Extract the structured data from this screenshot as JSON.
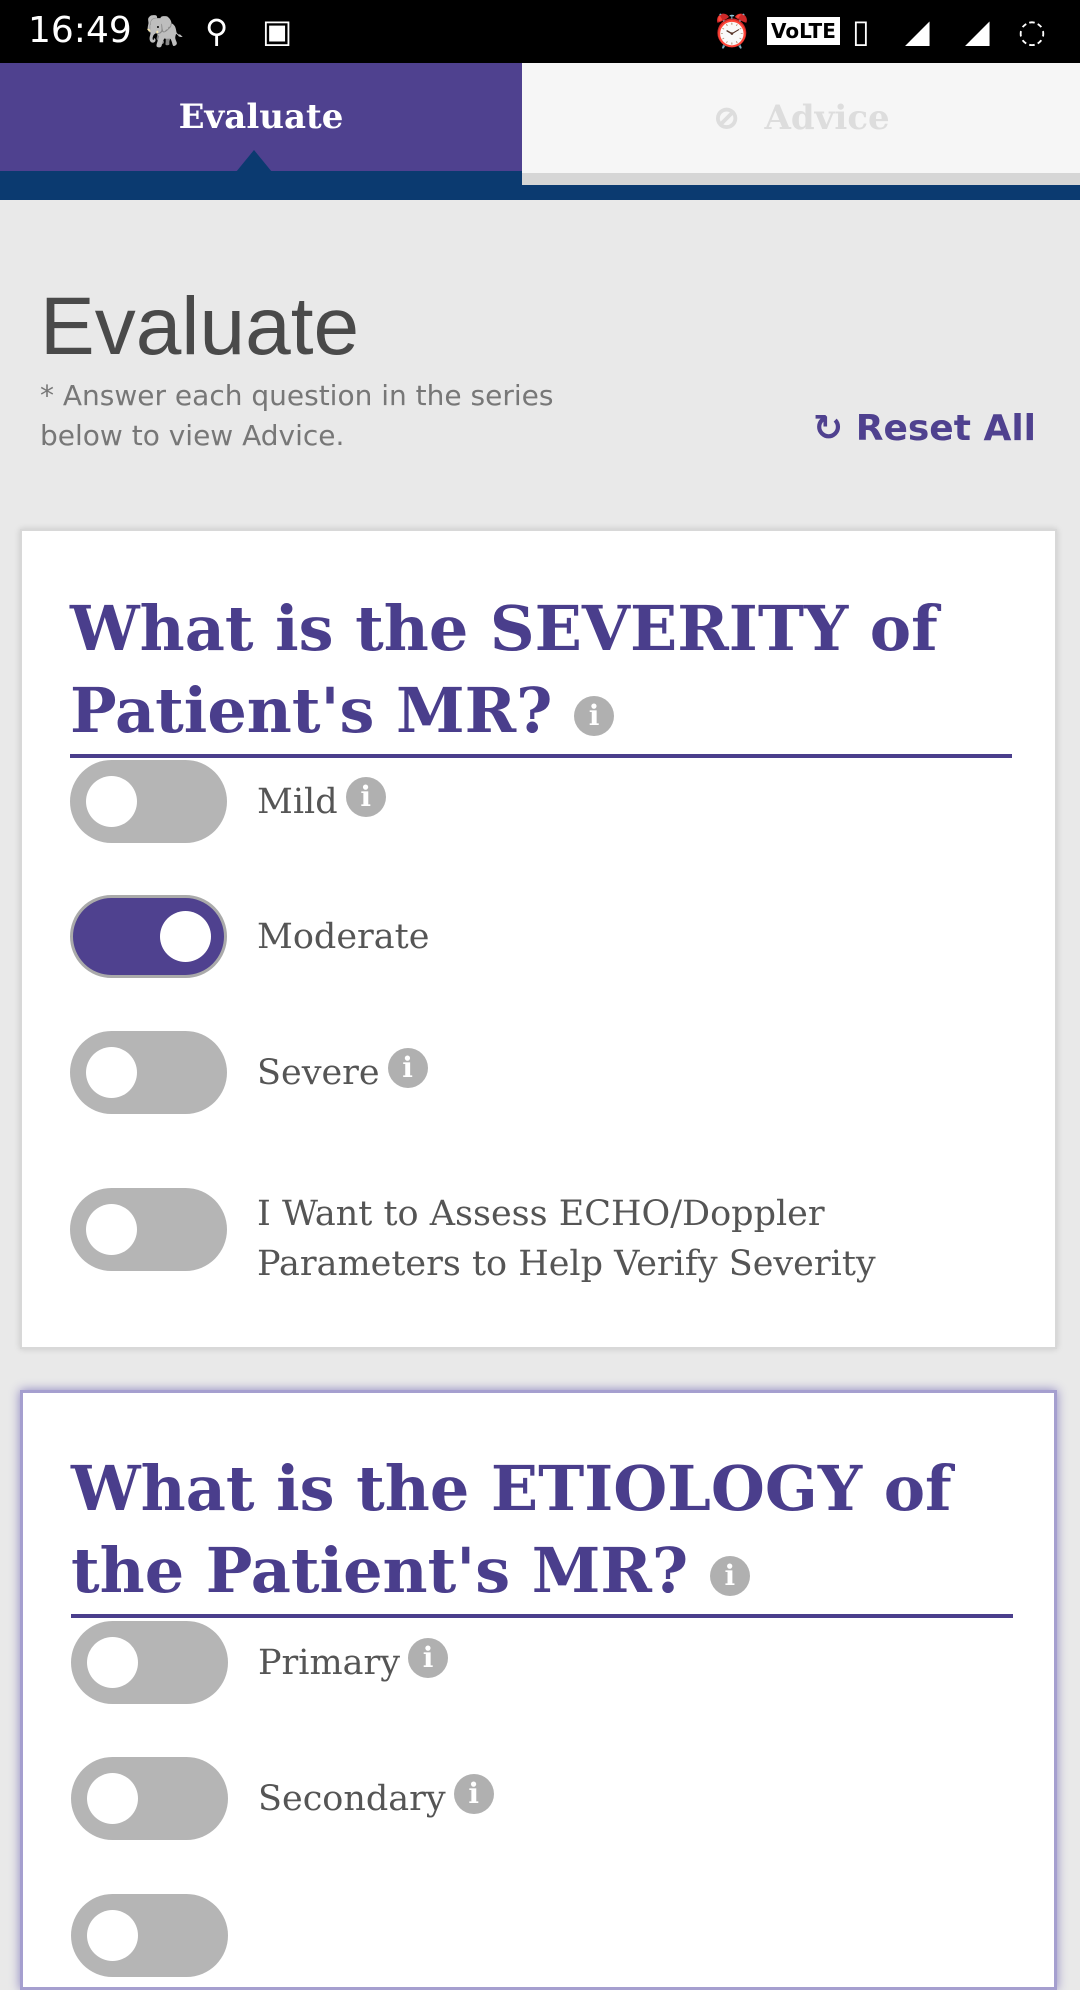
{
  "status_bar": {
    "time": "16:49",
    "icons": [
      "evernote-icon",
      "location-icon",
      "image-icon",
      "alarm-icon",
      "volte-icon",
      "vibrate-icon",
      "4g-signal-icon",
      "roaming-signal-icon",
      "battery-icon"
    ],
    "volte": "VoLTE"
  },
  "tabs": [
    {
      "label": "Evaluate",
      "active": true
    },
    {
      "label": "Advice",
      "active": false,
      "icon": "disabled-icon"
    }
  ],
  "page": {
    "title": "Evaluate",
    "subtitle": "* Answer each question in the series below to view Advice.",
    "reset_label": "Reset All"
  },
  "colors": {
    "accent": "#4f418f",
    "nav": "#0b3a70"
  },
  "questions": [
    {
      "title": "What is the SEVERITY of Patient's MR?",
      "options": [
        {
          "label": "Mild",
          "on": false,
          "info": true
        },
        {
          "label": "Moderate",
          "on": true,
          "info": false
        },
        {
          "label": "Severe",
          "on": false,
          "info": true
        },
        {
          "label": "I Want to Assess ECHO/Doppler Parameters to Help Verify Severity",
          "on": false,
          "info": false
        }
      ]
    },
    {
      "title": "What is the ETIOLOGY of the Patient's MR?",
      "options": [
        {
          "label": "Primary",
          "on": false,
          "info": true
        },
        {
          "label": "Secondary",
          "on": false,
          "info": true
        }
      ]
    }
  ]
}
